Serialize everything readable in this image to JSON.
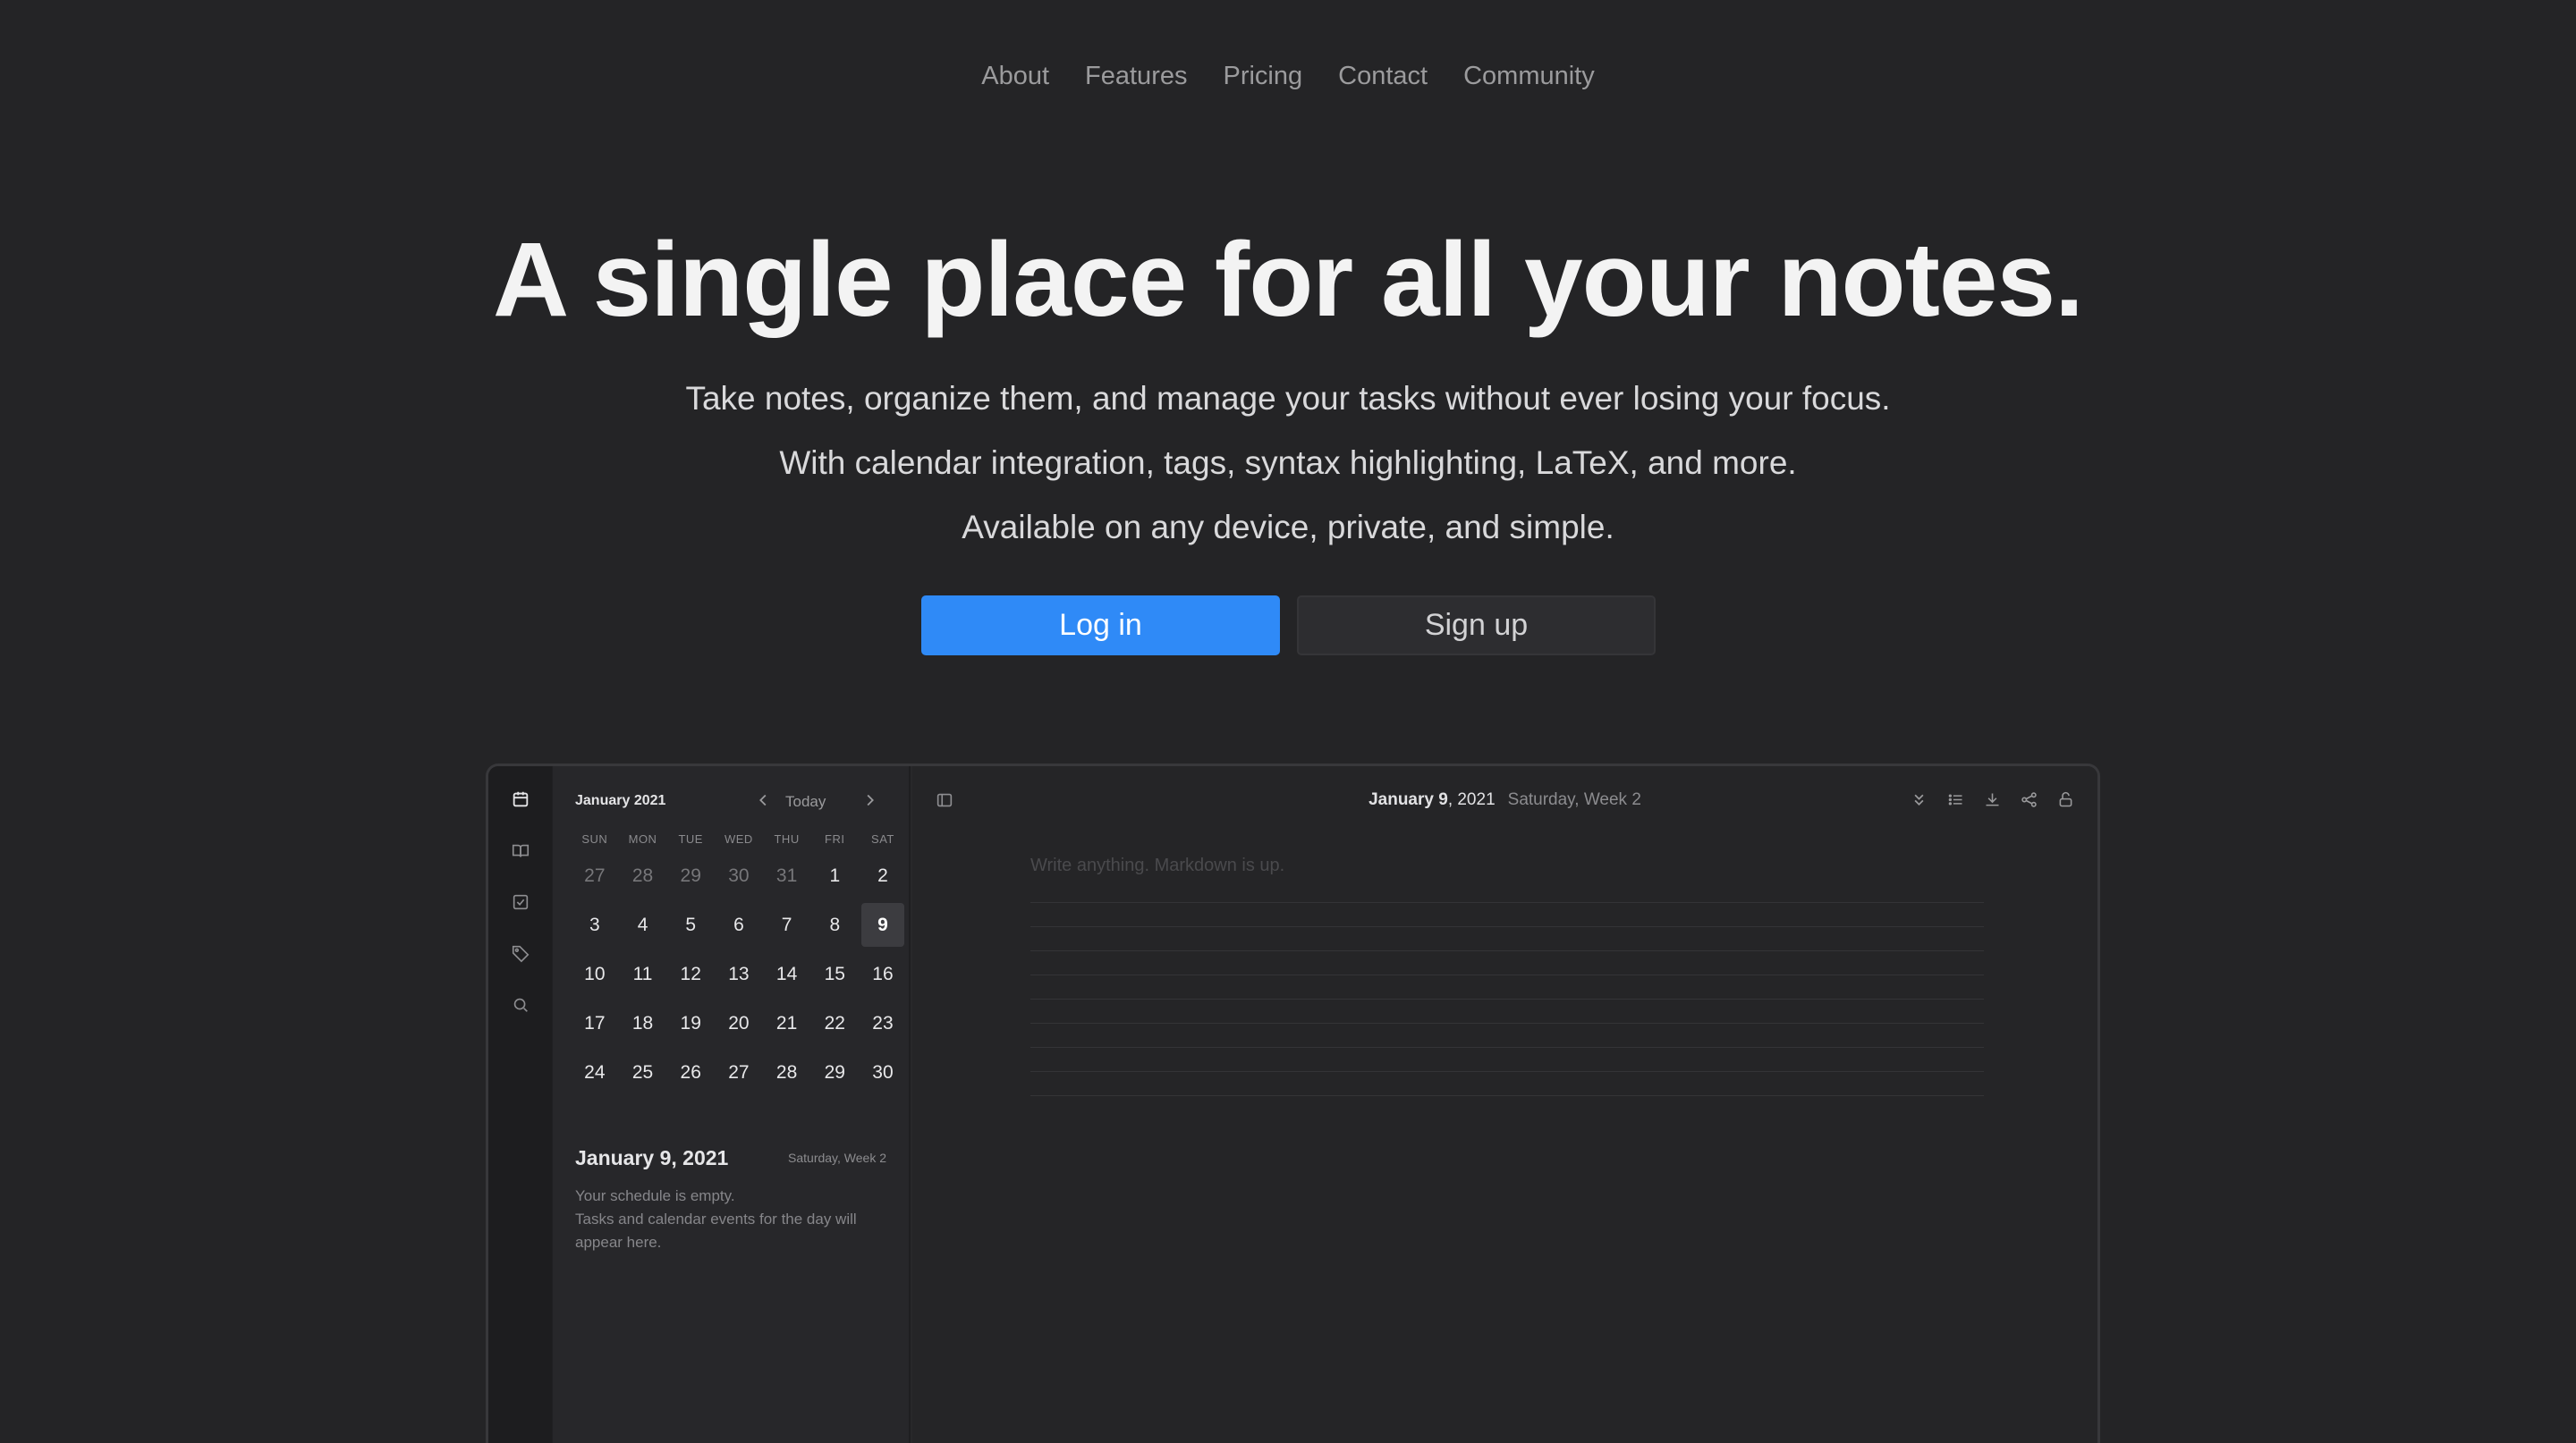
{
  "nav": {
    "items": [
      "About",
      "Features",
      "Pricing",
      "Contact",
      "Community"
    ]
  },
  "hero": {
    "title": "A single place for all your notes.",
    "lines": [
      "Take notes, organize them, and manage your tasks without ever losing your focus.",
      "With calendar integration, tags, syntax highlighting, LaTeX, and more.",
      "Available on any device, private, and simple."
    ],
    "login_label": "Log in",
    "signup_label": "Sign up"
  },
  "colors": {
    "background": "#242426",
    "accent": "#2f8af7"
  },
  "app": {
    "rail_icons": [
      "calendar-icon",
      "book-icon",
      "task-checkbox-icon",
      "tag-icon",
      "search-icon"
    ],
    "calendar": {
      "month_label": "January 2021",
      "today_label": "Today",
      "weekdays": [
        "SUN",
        "MON",
        "TUE",
        "WED",
        "THU",
        "FRI",
        "SAT"
      ],
      "days": [
        {
          "d": "27",
          "muted": true
        },
        {
          "d": "28",
          "muted": true
        },
        {
          "d": "29",
          "muted": true
        },
        {
          "d": "30",
          "muted": true
        },
        {
          "d": "31",
          "muted": true
        },
        {
          "d": "1"
        },
        {
          "d": "2"
        },
        {
          "d": "3"
        },
        {
          "d": "4"
        },
        {
          "d": "5"
        },
        {
          "d": "6"
        },
        {
          "d": "7"
        },
        {
          "d": "8"
        },
        {
          "d": "9",
          "selected": true
        },
        {
          "d": "10"
        },
        {
          "d": "11"
        },
        {
          "d": "12"
        },
        {
          "d": "13"
        },
        {
          "d": "14"
        },
        {
          "d": "15"
        },
        {
          "d": "16"
        },
        {
          "d": "17"
        },
        {
          "d": "18"
        },
        {
          "d": "19"
        },
        {
          "d": "20"
        },
        {
          "d": "21"
        },
        {
          "d": "22"
        },
        {
          "d": "23"
        },
        {
          "d": "24"
        },
        {
          "d": "25"
        },
        {
          "d": "26"
        },
        {
          "d": "27"
        },
        {
          "d": "28"
        },
        {
          "d": "29"
        },
        {
          "d": "30"
        }
      ]
    },
    "schedule": {
      "date": "January 9, 2021",
      "week": "Saturday, Week 2",
      "empty_line1": "Your schedule is empty.",
      "empty_line2": "Tasks and calendar events for the day will appear here."
    },
    "editor": {
      "title_bold": "January 9",
      "title_year": ", 2021",
      "title_sub": "Saturday, Week 2",
      "placeholder": "Write anything. Markdown is up.",
      "toolbar_icons": [
        "collapse-icon",
        "list-icon",
        "download-icon",
        "share-icon",
        "lock-icon"
      ]
    }
  }
}
